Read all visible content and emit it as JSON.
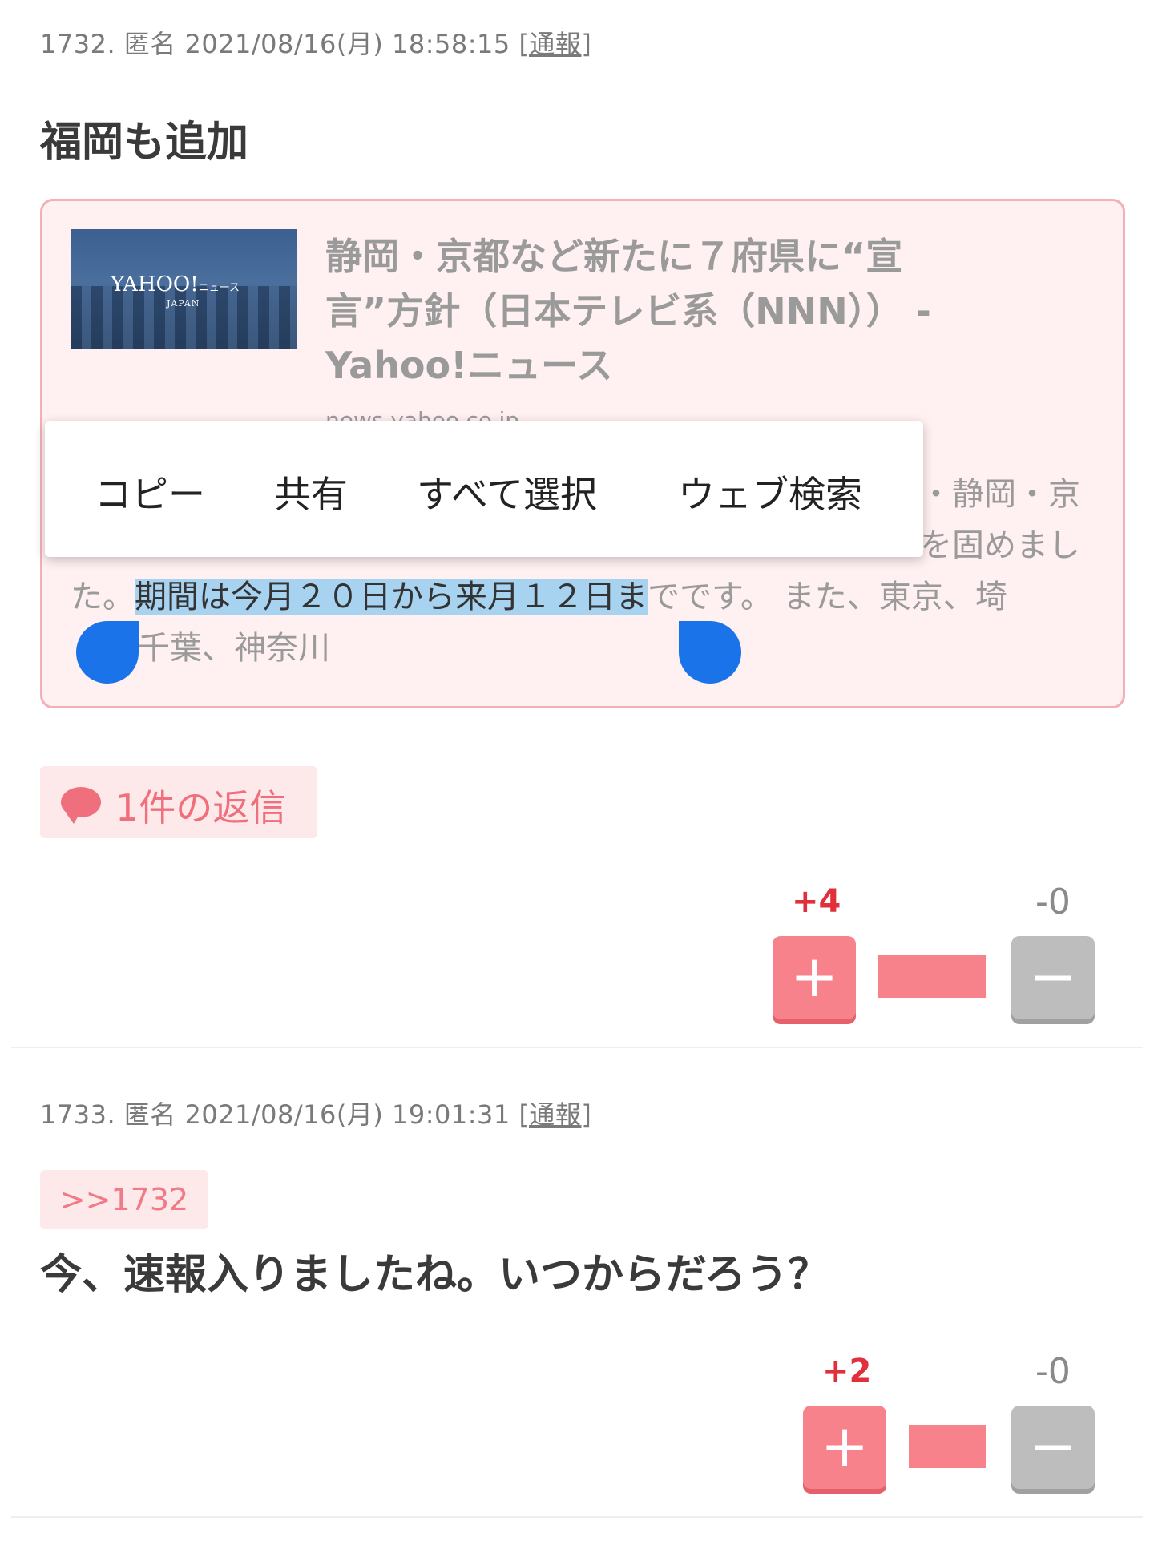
{
  "post1": {
    "meta_prefix": "1732. 匿名 2021/08/16(月) 18:58:15 ",
    "report_label": "[通報]",
    "title": "福岡も追加",
    "link_card": {
      "thumbnail_logo": "YAHOO!",
      "thumbnail_logo_suffix": "ニュース",
      "thumbnail_logo_sub": "JAPAN",
      "title": "静岡・京都など新たに７府県に“宣言”方針（日本テレビ系（NNN）） - Yahoo!ニュース",
      "domain": "news.yahoo.co.jp",
      "text_line1_end": "・静岡・京",
      "text_line2_end": "を固めまし",
      "text_line3_before": "た。",
      "text_line3_selected": "期間は今月２０日から来月１２日ま",
      "text_line3_after": "でです。 また、東京、埼",
      "text_line4_end": "千葉、神奈川"
    },
    "reply_label": "1件の返信",
    "plus_score": "+4",
    "minus_score": "-0",
    "plus_ratio": 1.0
  },
  "context_menu": {
    "copy": "コピー",
    "share": "共有",
    "select_all": "すべて選択",
    "web_search": "ウェブ検索"
  },
  "post2": {
    "meta_prefix": "1733. 匿名 2021/08/16(月) 19:01:31 ",
    "report_label": "[通報]",
    "anchor": ">>1732",
    "body": "今、速報入りましたね。いつからだろう？",
    "plus_score": "+2",
    "minus_score": "-0",
    "plus_ratio": 1.0
  },
  "icons": {
    "plus": "+",
    "minus": "−"
  },
  "colors": {
    "accent": "#f06f7c",
    "plus_score": "#e0303c",
    "selection": "#a8d3f0",
    "handle": "#1a73e8"
  }
}
